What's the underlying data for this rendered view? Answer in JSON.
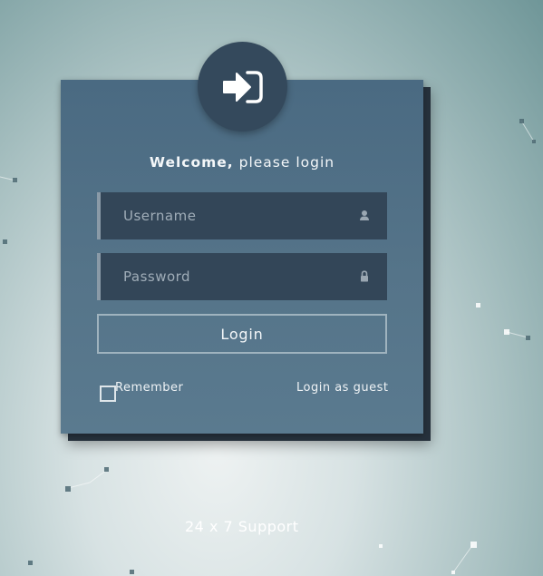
{
  "login_card": {
    "welcome_bold": "Welcome,",
    "welcome_rest": " please login",
    "username": {
      "placeholder": "Username",
      "value": "",
      "icon": "user-icon"
    },
    "password": {
      "placeholder": "Password",
      "value": "",
      "icon": "lock-icon"
    },
    "login_button": "Login",
    "remember_label": "Remember",
    "remember_checked": false,
    "guest_link": "Login as guest",
    "badge_icon": "sign-in-icon"
  },
  "footer": {
    "support_text": "24 x 7 Support"
  },
  "colors": {
    "card": "#557489",
    "field": "#334658",
    "badge": "#34495c",
    "text": "#f4f7f9"
  }
}
